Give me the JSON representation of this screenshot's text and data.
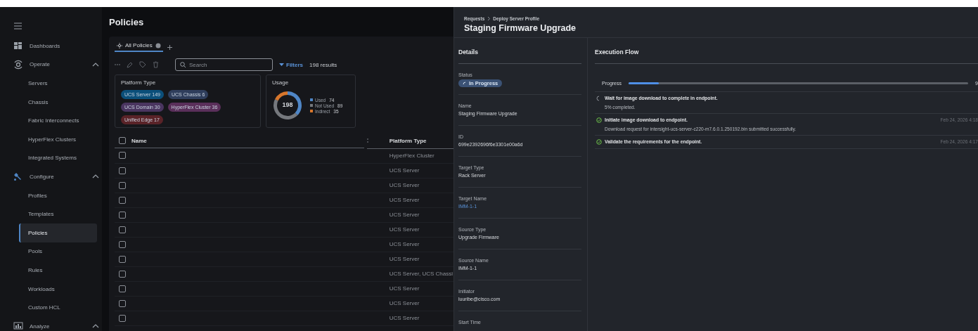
{
  "sidebar": {
    "sections": [
      {
        "kind": "link",
        "label": "Dashboards"
      },
      {
        "kind": "group",
        "label": "Operate",
        "expanded": true,
        "children": [
          {
            "label": "Servers",
            "selected": false
          },
          {
            "label": "Chassis",
            "selected": false
          },
          {
            "label": "Fabric Interconnects",
            "selected": false
          },
          {
            "label": "HyperFlex Clusters",
            "selected": false
          },
          {
            "label": "Integrated Systems",
            "selected": false
          }
        ]
      },
      {
        "kind": "group",
        "label": "Configure",
        "expanded": true,
        "children": [
          {
            "label": "Profiles",
            "selected": false
          },
          {
            "label": "Templates",
            "selected": false
          },
          {
            "label": "Policies",
            "selected": true
          },
          {
            "label": "Pools",
            "selected": false
          },
          {
            "label": "Rules",
            "selected": false
          },
          {
            "label": "Workloads",
            "selected": false
          },
          {
            "label": "Custom HCL",
            "selected": false
          }
        ]
      },
      {
        "kind": "group",
        "label": "Analyze",
        "expanded": true
      }
    ]
  },
  "main": {
    "title": "Policies",
    "tabs": [
      {
        "label": "All Policies",
        "selected": true
      }
    ],
    "search": {
      "placeholder": "Search"
    },
    "filters": "Filters",
    "results": "198 results",
    "platform_card": {
      "title": "Platform Type",
      "tags": [
        {
          "label": "UCS Server 149",
          "color": "#0b4f7a"
        },
        {
          "label": "UCS Chassis 6",
          "color": "#2f3e5c"
        },
        {
          "label": "UCS Domain 30",
          "color": "#4a3560"
        },
        {
          "label": "HyperFlex Cluster 36",
          "color": "#5a2f5a"
        },
        {
          "label": "Unified Edge 17",
          "color": "#5a2328"
        }
      ]
    },
    "usage_card": {
      "title": "Usage",
      "total": "198",
      "legend": [
        {
          "label": "Used",
          "value": "74",
          "color": "#4f86c6"
        },
        {
          "label": "Not Used",
          "value": "89",
          "color": "#75787d"
        },
        {
          "label": "Indirect",
          "value": "35",
          "color": "#d7762c"
        }
      ]
    },
    "table": {
      "columns": [
        "Name",
        "Platform Type"
      ],
      "header_checked": false,
      "rows": [
        {
          "checked": false,
          "platform_type": "HyperFlex Cluster"
        },
        {
          "checked": false,
          "platform_type": "UCS Server"
        },
        {
          "checked": false,
          "platform_type": "UCS Server"
        },
        {
          "checked": false,
          "platform_type": "UCS Server"
        },
        {
          "checked": false,
          "platform_type": "UCS Server"
        },
        {
          "checked": false,
          "platform_type": "UCS Server"
        },
        {
          "checked": false,
          "platform_type": "UCS Server"
        },
        {
          "checked": false,
          "platform_type": "UCS Server"
        },
        {
          "checked": false,
          "platform_type": "UCS Server, UCS Chassi"
        },
        {
          "checked": false,
          "platform_type": "UCS Server"
        },
        {
          "checked": false,
          "platform_type": "UCS Server"
        },
        {
          "checked": false,
          "platform_type": "UCS Server"
        }
      ]
    }
  },
  "request_panel": {
    "breadcrumb": [
      "Requests",
      "Deploy Server Profile"
    ],
    "title": "Staging Firmware Upgrade",
    "details": {
      "heading": "Details",
      "fields": [
        {
          "kind": "status",
          "label": "Status",
          "value": "In Progress"
        },
        {
          "kind": "text",
          "label": "Name",
          "value": "Staging Firmware Upgrade"
        },
        {
          "kind": "text",
          "label": "ID",
          "value": "699e2392696f6e3301e00a6d"
        },
        {
          "kind": "text",
          "label": "Target Type",
          "value": "Rack Server"
        },
        {
          "kind": "link",
          "label": "Target Name",
          "value": "IMM-1-1"
        },
        {
          "kind": "text",
          "label": "Source Type",
          "value": "Upgrade Firmware"
        },
        {
          "kind": "text",
          "label": "Source Name",
          "value": "IMM-1-1"
        },
        {
          "kind": "text",
          "label": "Initiator",
          "value": "luuribe@cisco.com"
        },
        {
          "kind": "text",
          "label": "Start Time"
        }
      ]
    },
    "execution": {
      "heading": "Execution Flow",
      "progress": {
        "label": "Progress",
        "level": 0.09,
        "reading": "9"
      },
      "steps": [
        {
          "completed": false,
          "title": "Wait for image download to complete in endpoint.",
          "detail": "5% completed."
        },
        {
          "completed": true,
          "title": "Initiate image download to endpoint.",
          "detail": "Download request for intersight-ucs-server-c220-m7.6.0.1.250192.bin submitted successfully.",
          "time": "Feb 24, 2026 4:18"
        },
        {
          "completed": true,
          "title": "Validate the requirements for the endpoint.",
          "time": "Feb 24, 2026 4:17"
        }
      ]
    }
  }
}
